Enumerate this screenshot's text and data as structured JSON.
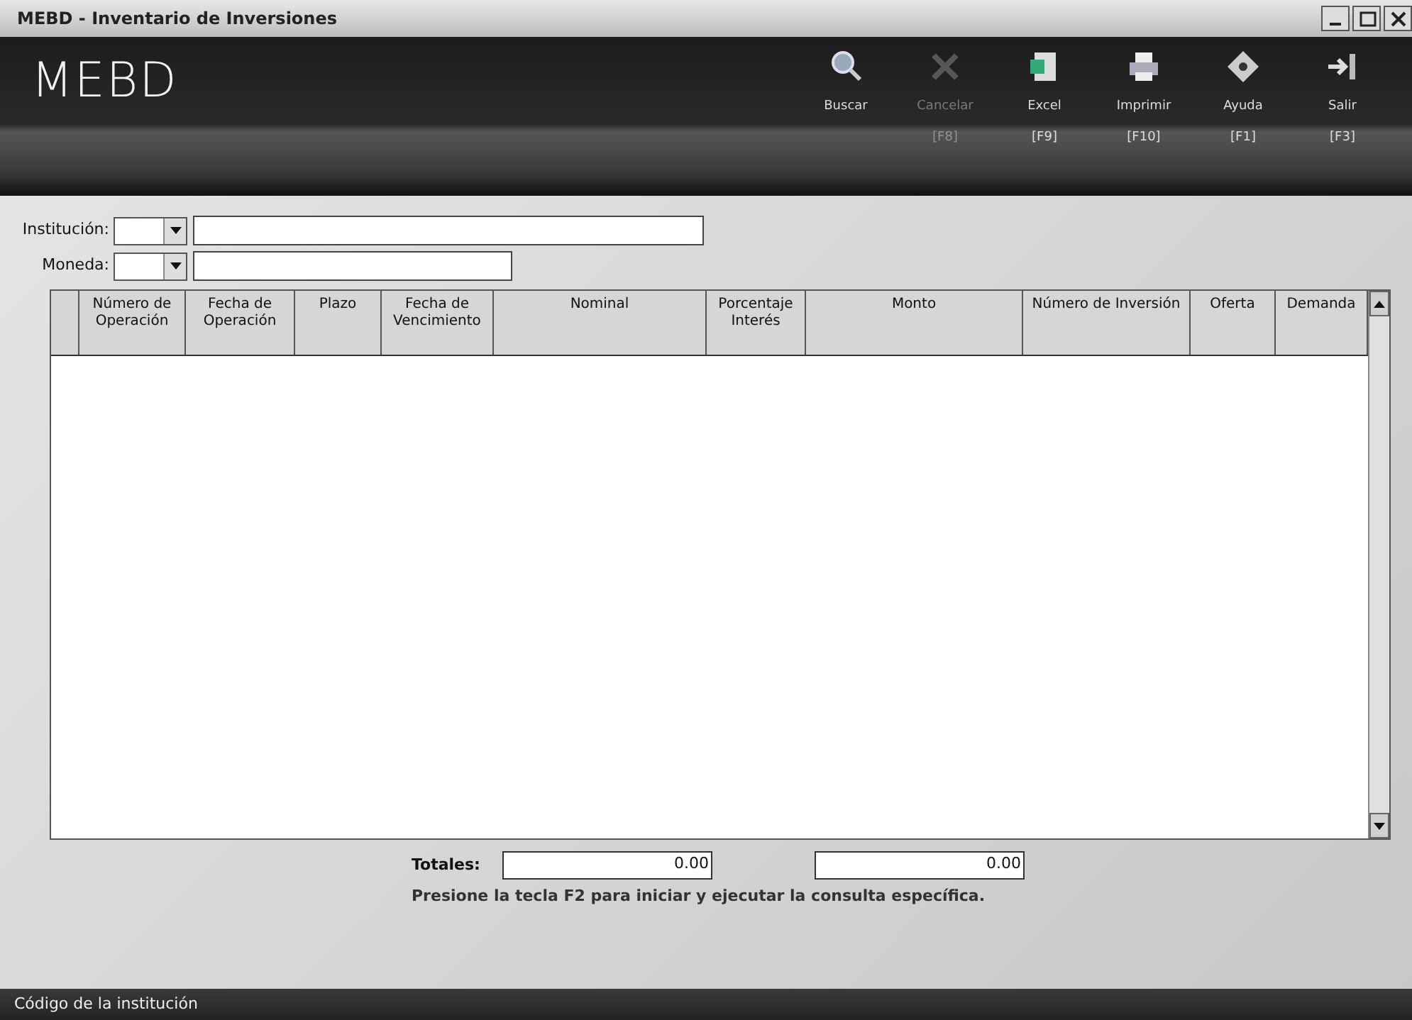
{
  "window": {
    "title": "MEBD - Inventario de Inversiones"
  },
  "header": {
    "logo": "MEBD"
  },
  "toolbar": [
    {
      "kind": "search",
      "label": "Buscar",
      "disabled": false
    },
    {
      "kind": "cancel",
      "label": "Cancelar",
      "key": "[F8]",
      "disabled": true
    },
    {
      "kind": "excel",
      "label": "Excel",
      "key": "[F9]",
      "disabled": false
    },
    {
      "kind": "print",
      "label": "Imprimir",
      "key": "[F10]",
      "disabled": false
    },
    {
      "kind": "help",
      "label": "Ayuda",
      "key": "[F1]",
      "disabled": false
    },
    {
      "kind": "exit",
      "label": "Salir",
      "key": "[F3]",
      "disabled": false
    }
  ],
  "filters": [
    {
      "label": "Institución:"
    },
    {
      "label": "Moneda:"
    }
  ],
  "table": {
    "columns": [
      "Número de Operación",
      "Fecha de Operación",
      "Plazo",
      "Fecha de Vencimiento",
      "Nominal",
      "Porcentaje Interés",
      "Monto",
      "Número de Inversión",
      "Oferta",
      "Demanda"
    ]
  },
  "totals": {
    "label": "Totales:",
    "values": [
      "0.00",
      "0.00"
    ]
  },
  "hint": "Presione la tecla F2 para iniciar y ejecutar la consulta específica.",
  "status_bar": "Código de la institución"
}
